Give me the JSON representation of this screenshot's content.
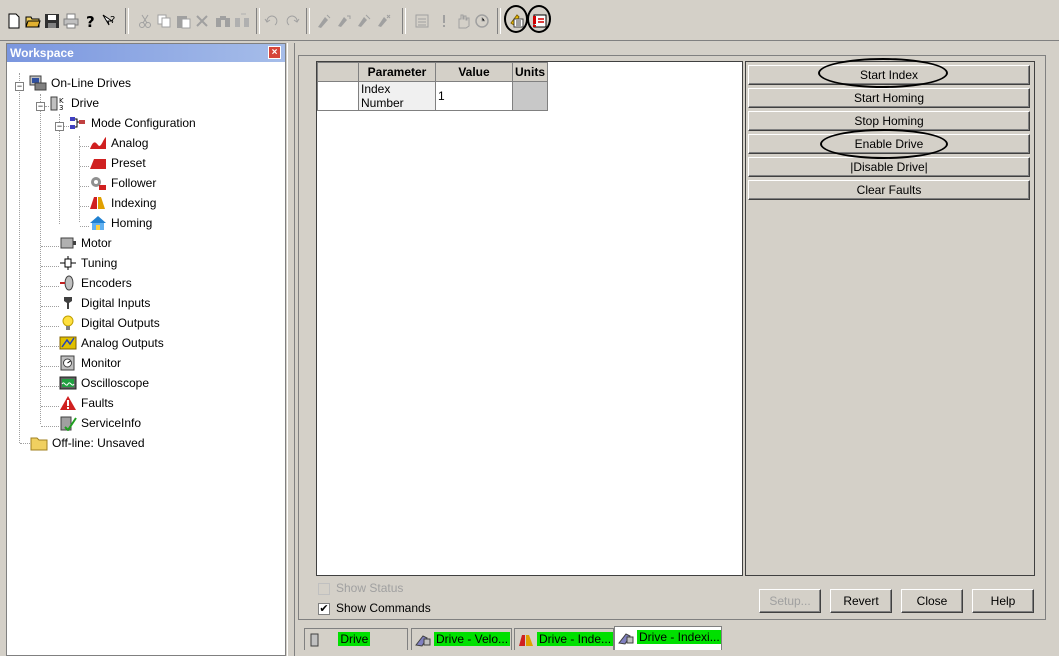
{
  "toolbar": {
    "icons": [
      "new-file-icon",
      "open-folder-icon",
      "save-icon",
      "print-icon",
      "help-icon",
      "context-help-icon",
      "cut-icon",
      "copy-icon",
      "paste-icon",
      "delete-icon",
      "find-icon",
      "find-next-icon",
      "undo-icon",
      "redo-icon",
      "connect-icon",
      "upload-icon",
      "download-icon",
      "disconnect-icon",
      "calculator-icon",
      "exclamation-icon",
      "stop-hand-icon",
      "clock-icon",
      "drive-status-icon",
      "fault-status-icon"
    ]
  },
  "workspace": {
    "title": "Workspace",
    "close": "×",
    "tree": {
      "online": "On-Line Drives",
      "drive": "Drive",
      "mode_config": "Mode Configuration",
      "analog": "Analog",
      "preset": "Preset",
      "follower": "Follower",
      "indexing": "Indexing",
      "homing": "Homing",
      "motor": "Motor",
      "tuning": "Tuning",
      "encoders": "Encoders",
      "digital_inputs": "Digital Inputs",
      "digital_outputs": "Digital Outputs",
      "analog_outputs": "Analog Outputs",
      "monitor": "Monitor",
      "oscilloscope": "Oscilloscope",
      "faults": "Faults",
      "serviceinfo": "ServiceInfo",
      "offline": "Off-line: Unsaved"
    }
  },
  "grid": {
    "headers": [
      "Parameter",
      "Value",
      "Units"
    ],
    "rows": [
      {
        "parameter": "Index Number",
        "value": "1",
        "units": ""
      }
    ]
  },
  "commands": [
    "Start Index",
    "Start Homing",
    "Stop Homing",
    "Enable Drive",
    "|Disable Drive|",
    "Clear Faults"
  ],
  "options": {
    "show_status": "Show Status",
    "show_status_checked": false,
    "show_commands": "Show Commands",
    "show_commands_checked": true,
    "checkmark": "✔"
  },
  "buttons": {
    "setup": "Setup...",
    "revert": "Revert",
    "close": "Close",
    "help": "Help"
  },
  "tabs": [
    {
      "label": "Drive",
      "icon": "drive-icon"
    },
    {
      "label": "Drive - Velo...",
      "icon": "velocity-icon"
    },
    {
      "label": "Drive - Inde...",
      "icon": "indexing-icon"
    },
    {
      "label": "Drive - Indexi...",
      "icon": "velocity-icon"
    }
  ],
  "colors": {
    "tab_highlight": "#00e000",
    "workspace_title": "#7a96df"
  }
}
